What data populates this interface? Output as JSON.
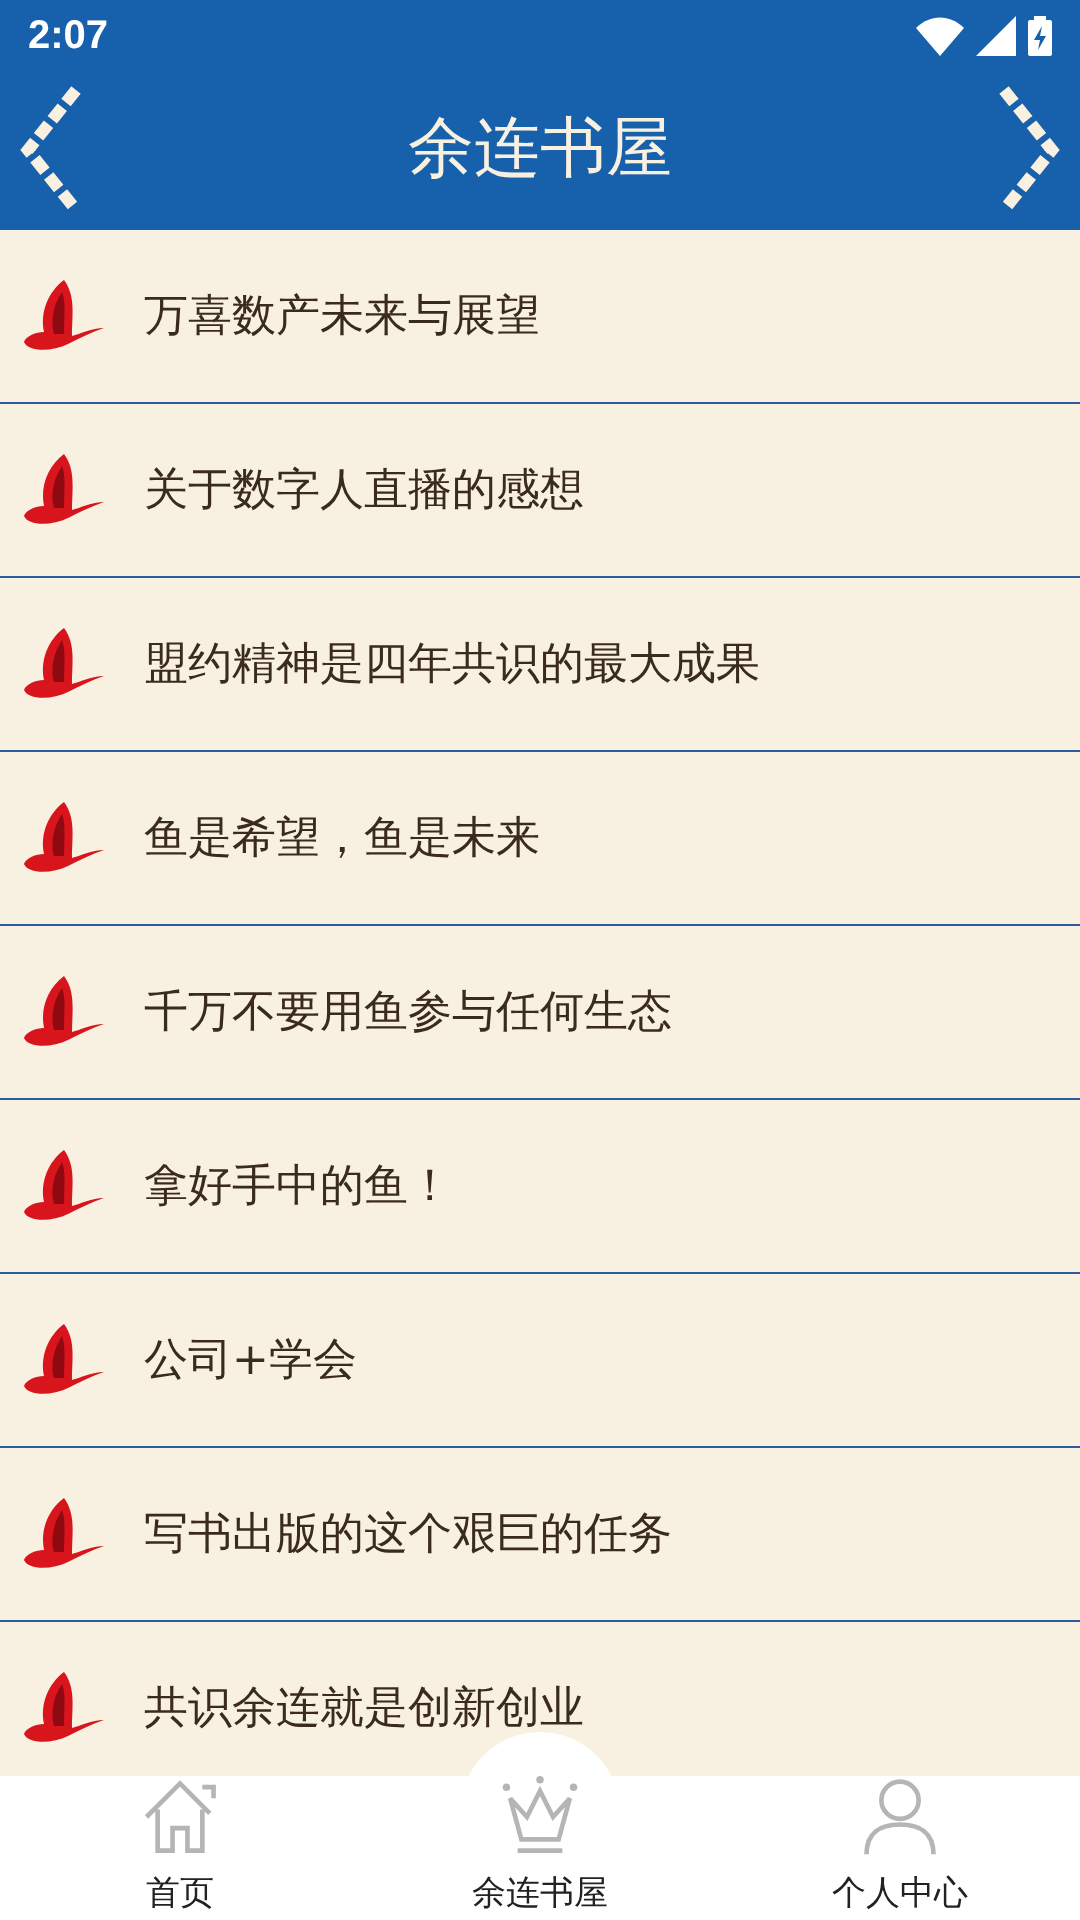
{
  "status_bar": {
    "time": "2:07"
  },
  "header": {
    "title": "余连书屋"
  },
  "articles": [
    {
      "title": "万喜数产未来与展望"
    },
    {
      "title": "关于数字人直播的感想"
    },
    {
      "title": "盟约精神是四年共识的最大成果"
    },
    {
      "title": "鱼是希望，鱼是未来"
    },
    {
      "title": "千万不要用鱼参与任何生态"
    },
    {
      "title": "拿好手中的鱼！"
    },
    {
      "title": "公司+学会"
    },
    {
      "title": "写书出版的这个艰巨的任务"
    },
    {
      "title": "共识余连就是创新创业"
    }
  ],
  "bottom_nav": [
    {
      "kind": "home",
      "label": "首页"
    },
    {
      "kind": "crown",
      "label": "余连书屋"
    },
    {
      "kind": "person",
      "label": "个人中心"
    }
  ]
}
